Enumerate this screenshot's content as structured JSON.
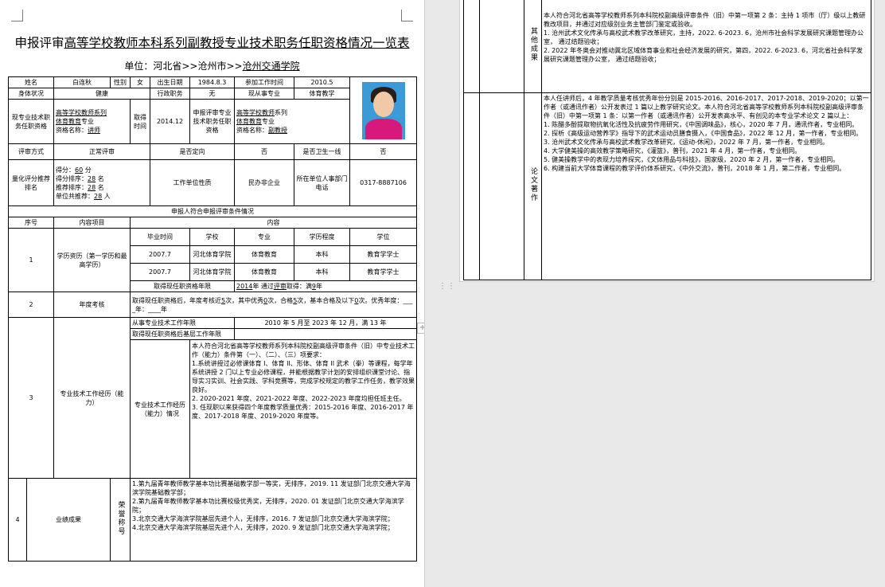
{
  "title": {
    "prefix": "申报评审",
    "underlined": "高等学校教师本科系列副教授专业技术职务任职资格情况一览表"
  },
  "unit": {
    "label": "单位：河北省>>沧州市>>",
    "value": "沧州交通学院"
  },
  "basic": {
    "name_label": "姓名",
    "name": "白连秋",
    "gender_label": "性别",
    "gender": "女",
    "birth_label": "出生日期",
    "birth": "1984.8.3",
    "work_start_label": "参加工作时间",
    "work_start": "2010.5",
    "health_label": "身体状况",
    "health": "健康",
    "admin_label": "行政职务",
    "admin": "无",
    "major_label": "现从事专业",
    "major": "体育教学",
    "current_title_label": "现专业技术职务任职资格",
    "current_series": "高等学校教师系列",
    "current_major": "体育教育",
    "current_major_suffix": "专业",
    "current_title_name_label": "资格名称：",
    "current_title_name": "讲师",
    "obtain_time_label": "取得时间",
    "obtain_time": "2014.12",
    "apply_label": "申报评审专业技术职务任职资格",
    "apply_series": "高等学校教师",
    "apply_series_suffix": "系列",
    "apply_major": "体育教育",
    "apply_major_suffix": "专业",
    "apply_name_label": "资格名称：",
    "apply_name": "副教授"
  },
  "review": {
    "method_label": "评审方式",
    "method": "正常评审",
    "directed_label": "是否定向",
    "directed": "否",
    "frontline_label": "是否卫生一线",
    "frontline": "否"
  },
  "score": {
    "label": "量化评分推荐排名",
    "score_label": "得分：",
    "score": "60",
    "score_unit": "分",
    "rank_label": "得分排序：",
    "rank": "28",
    "rank_unit": "名",
    "recommend_label": "推荐排序：",
    "recommend": "28",
    "recommend_unit": "名",
    "unit_total_label": "单位共推荐：",
    "unit_total": "28",
    "unit_total_unit": "人",
    "nature_label": "工作单位性质",
    "nature": "民办非企业",
    "phone_label": "所在单位人事部门电话",
    "phone": "0317-8887106"
  },
  "conditions": {
    "header": "申报人符合申报评审条件情况",
    "col_no": "序号",
    "col_item": "内容项目",
    "col_content": "内容"
  },
  "edu": {
    "no": "1",
    "label": "学历资历（第一学历和最高学历）",
    "headers": [
      "毕业时间",
      "学校",
      "专业",
      "学历程度",
      "学位"
    ],
    "rows": [
      [
        "2007.7",
        "河北体育学院",
        "体育教育",
        "本科",
        "教育学学士"
      ],
      [
        "2007.7",
        "河北体育学院",
        "体育教育",
        "本科",
        "教育学学士"
      ]
    ],
    "years_label": "取得现任职资格年限",
    "years_year": "2014",
    "years_mid": "年 通过",
    "years_method": "评审",
    "years_mid2": "取得：满",
    "years_count": "9",
    "years_end": "年"
  },
  "annual": {
    "no": "2",
    "label": "年度考核",
    "t1": "取得现任职资格后，年度考核近",
    "n1": "5",
    "t2": "次，其中优秀",
    "n2": "0",
    "t3": "次，合格",
    "n3": "5",
    "t4": "次，基本合格及以下",
    "n4": "0",
    "t5": "次。优秀年度：",
    "n5": "",
    "t6": "年：",
    "n6": "",
    "t7": "年"
  },
  "work": {
    "no": "3",
    "label": "专业技术工作经历（能力）",
    "years_label": "从事专业技术工作年限",
    "years_value": "2010 年 5 月至 2023 年 12 月，满 13 年",
    "after_label": "取得现任职资格后基层工作年限",
    "after_value": "",
    "sub_label": "专业技术工作经历（能力）情况",
    "paras": [
      "本人符合河北省高等学校教师系列本科院校副高级评审条件（旧）中专业技术工作（能力）条件第（一）、（二）、（三）项要求：",
      "1.系统讲授过必修课体育 I、体育 II、形体、体育 II 武术（拳）等课程，每学年系统讲授 2 门以上专业必修课程，并能根据教学计划的安排组织课堂讨论、指导实习实训、社会实践、学科竞赛等，完成学校规定的教学工作任务，教学效果良好。",
      "2. 2020-2021 年度、2021-2022 年度、2022-2023 年度均担任班主任。",
      "3. 任现职以来获得四个年度教学质量优秀：2015-2016 年度、2016-2017 年度、2017-2018 年度、2019-2020 年度等。"
    ]
  },
  "results": {
    "no": "4",
    "label": "业绩成果",
    "honor_label": "荣誉称号",
    "items": [
      "1.第九届青年教师教学基本功比赛基础教学部一等奖，无排序，2019. 11 发证部门北京交通大学海滨学院基础教学部；",
      "2.第九届青年教师教学基本功比赛校级优秀奖，无排序，2020. 01 发证部门北京交通大学海滨学院；",
      "3.北京交通大学海滨学院基层先进个人，无排序，2016. 7 发证部门北京交通大学海滨学院；",
      "4.北京交通大学海滨学院基层先进个人，无排序，2020. 9 发证部门北京交通大学海滨学院；"
    ]
  },
  "other": {
    "label": "其他成果",
    "paras": [
      "本人符合河北省高等学校教师系列本科院校副高级评审条件（旧）中第一项第 2 条：主持 1 项市（厅）级以上教研教改项目，并通过对应级别业务主管部门鉴定或验收。",
      "1. 沧州武术文化传承与高校武术教学改革研究，主持，2022. 6-2023. 6，沧州市社会科学发展研究课题管理办公室， 通过结题验收；",
      "2. 2022 年冬奥会对推动冀北区域体育事业和社会经济发展的研究，第四，2022. 6-2023. 6，河北省社会科学发展研究课题管理办公室， 通过结题验收；"
    ]
  },
  "papers": {
    "label": "论文著作",
    "paras": [
      "本人任讲师后，4 年教学质量考核优秀年份分别是 2015-2016、2016-2017、2017-2018、2019-2020；以第一作者（或通讯作者）公开发表过 1 篇以上教学研究论文。本人符合河北省高等学校教师系列本科院校副高级评审条件（旧）中第一项第 1 条：以第一作者（或通讯作者）公开发表高水平、有创见的本专业学术论文 2 篇以上：",
      "1. 陈醋多酚提取物抗氧化活性及抗疲劳作用研究，《中国调味品》，核心，2020 年 7 月，通讯作者，专业相同。",
      "2. 探析《高级运动营养学》指导下的武术运动员膳食摄入，《中国食品》，2022 年 12 月，第一作者，专业相同。",
      "3. 沧州武术文化传承与高校武术教学改革研究，《运动-休闲》，2022 年 7 月，第一作者，专业相同。",
      "4. 大学健美操的高效教学策略研究，《灌篮》，普刊，2021 年 4 月，第一作者，专业相同。",
      "5. 健美操教学中的表现力培养探究，《文体用品与科技》，国家级，2020 年 2 月，第一作者，专业相同。",
      "6. 构建当前大学体育课程的教学评价体系研究，《中外交流》，普刊，2018 年 1 月，第二作者，专业相同。"
    ]
  },
  "ui": {
    "plus_icon": "+",
    "drag_icon": "⋮⋮"
  }
}
